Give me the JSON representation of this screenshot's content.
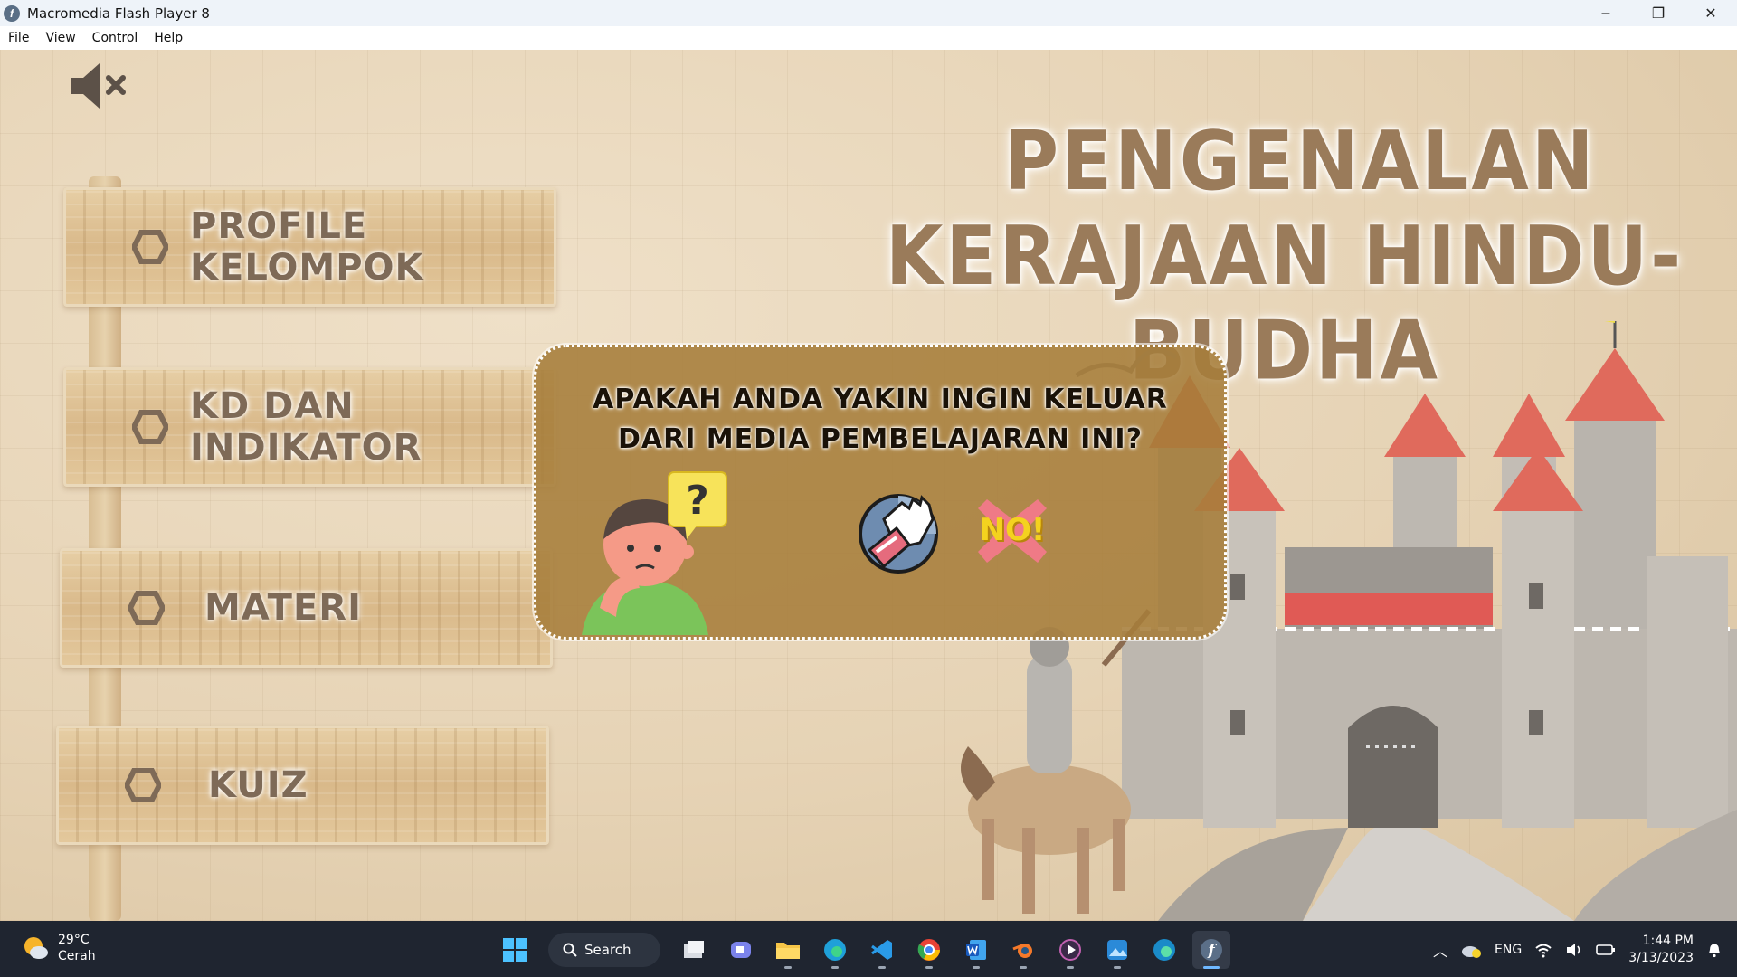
{
  "window": {
    "title": "Macromedia Flash Player 8",
    "minimize": "–",
    "maximize": "❐",
    "close": "✕"
  },
  "menu": [
    "File",
    "View",
    "Control",
    "Help"
  ],
  "stage": {
    "title_line1": "PENGENALAN",
    "title_line2": "KERAJAAN HINDU-BUDHA",
    "mute_icon": "speaker-muted-icon",
    "menu_boards": [
      {
        "label": "PROFILE KELOMPOK"
      },
      {
        "label": "KD DAN INDIKATOR"
      },
      {
        "label": "MATERI"
      },
      {
        "label": "KUIZ"
      }
    ]
  },
  "dialog": {
    "line1": "APAKAH ANDA YAKIN INGIN KELUAR",
    "line2": "DARI MEDIA PEMBELAJARAN INI?",
    "question_mark": "?",
    "yes_icon": "hand-wave-icon",
    "no_label": "NO!"
  },
  "taskbar": {
    "weather_temp": "29°C",
    "weather_desc": "Cerah",
    "search_label": "Search",
    "language": "ENG",
    "time": "1:44 PM",
    "date": "3/13/2023"
  },
  "colors": {
    "title_text": "#9a7b5a",
    "dialog_bg": "#a67d3a",
    "taskbar_bg": "#1f2530",
    "no_yellow": "#f4d21f"
  }
}
